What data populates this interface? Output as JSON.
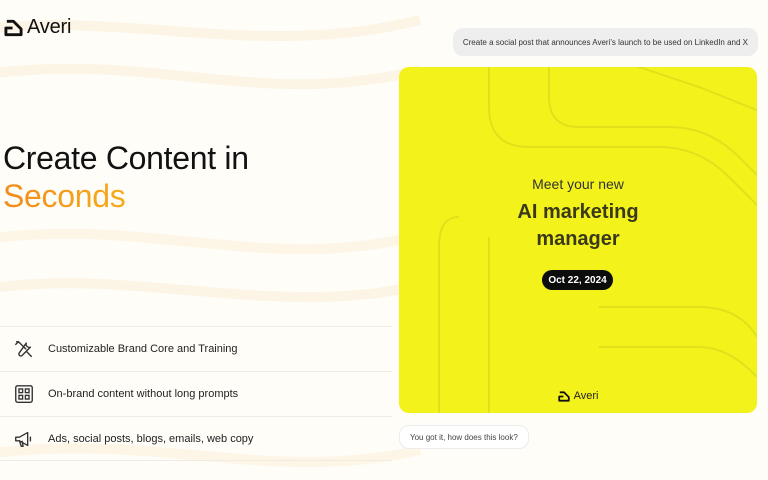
{
  "brand": {
    "name": "Averi",
    "logo_icon": "averi-logo-icon"
  },
  "hero": {
    "line1": "Create Content in",
    "line2": "Seconds",
    "accent_gradient": [
      "#f28c1c",
      "#f9c72a"
    ]
  },
  "features": [
    {
      "icon": "tools-icon",
      "label": "Customizable Brand Core and Training"
    },
    {
      "icon": "grid-icon",
      "label": "On-brand content without long prompts"
    },
    {
      "icon": "megaphone-icon",
      "label": "Ads, social posts, blogs, emails, web copy"
    }
  ],
  "chat": {
    "prompt": "Create a social post that announces Averi's launch to be used on LinkedIn and X",
    "reply": "You got it, how does this look?"
  },
  "post_card": {
    "background": "#f4f21b",
    "subtitle": "Meet your new",
    "title_line1": "AI marketing",
    "title_line2": "manager",
    "date": "Oct 22, 2024",
    "brand_name": "Averi"
  }
}
